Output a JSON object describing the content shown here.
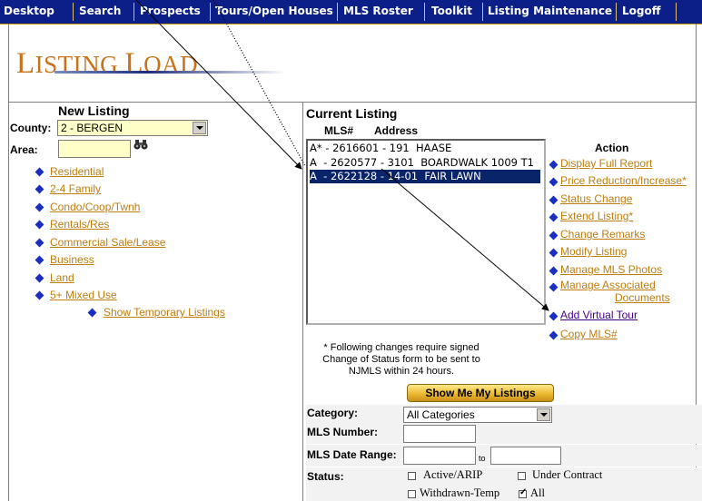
{
  "nav": {
    "items": [
      "Desktop",
      "Search",
      "Prospects",
      "Tours/Open Houses",
      "MLS Roster",
      "Toolkit",
      "Listing Maintenance",
      "Logoff"
    ]
  },
  "header": {
    "title_first": "L",
    "title_rest1": "ISTING ",
    "title_second": "L",
    "title_rest2": "OAD"
  },
  "new_listing": {
    "heading": "New Listing",
    "county_label": "County:",
    "county_value": "2 - BERGEN",
    "area_label": "Area:",
    "area_value": "",
    "links": [
      "Residential",
      "2-4 Family",
      "Condo/Coop/Twnh",
      "Rentals/Res",
      "Commercial Sale/Lease",
      "Business",
      "Land",
      "5+ Mixed Use"
    ],
    "temp_link": "Show Temporary Listings"
  },
  "current_listing": {
    "heading": "Current Listing",
    "col_mls": "MLS#",
    "col_address": "Address",
    "rows": [
      "A* - 2616601 - 191  HAASE",
      "A  - 2620577 - 3101  BOARDWALK 1009 T1",
      "A  - 2622128 - 14-01  FAIR LAWN"
    ],
    "selected_index": 2,
    "note": "* Following changes require signed Change of Status form to be sent to NJMLS within 24 hours.",
    "note_lines": [
      "* Following changes require signed",
      "Change of Status form to be sent to",
      "NJMLS within 24 hours."
    ],
    "show_button": "Show Me My Listings"
  },
  "actions": {
    "heading": "Action",
    "items": [
      "Display Full Report",
      "Price Reduction/Increase*",
      "Status Change",
      "Extend Listing*",
      "Change Remarks",
      "Modify Listing",
      "Manage MLS Photos",
      "Manage Associated",
      "Documents",
      "Add Virtual Tour",
      "Copy MLS#"
    ]
  },
  "filters": {
    "category_label": "Category:",
    "category_value": "All Categories",
    "mls_number_label": "MLS Number:",
    "mls_number_value": "",
    "date_range_label": "MLS Date Range:",
    "date_to": "to",
    "status_label": "Status:",
    "status_options": [
      {
        "label": "Active/ARIP",
        "checked": false
      },
      {
        "label": "Under Contract",
        "checked": false
      },
      {
        "label": "Withdrawn-Temp",
        "checked": false
      },
      {
        "label": "All",
        "checked": true
      }
    ]
  },
  "colors": {
    "nav_bg": "#0c1f88",
    "title": "#c8731b",
    "link": "#c07d10",
    "visited": "#400080",
    "selection": "#0a246a"
  }
}
